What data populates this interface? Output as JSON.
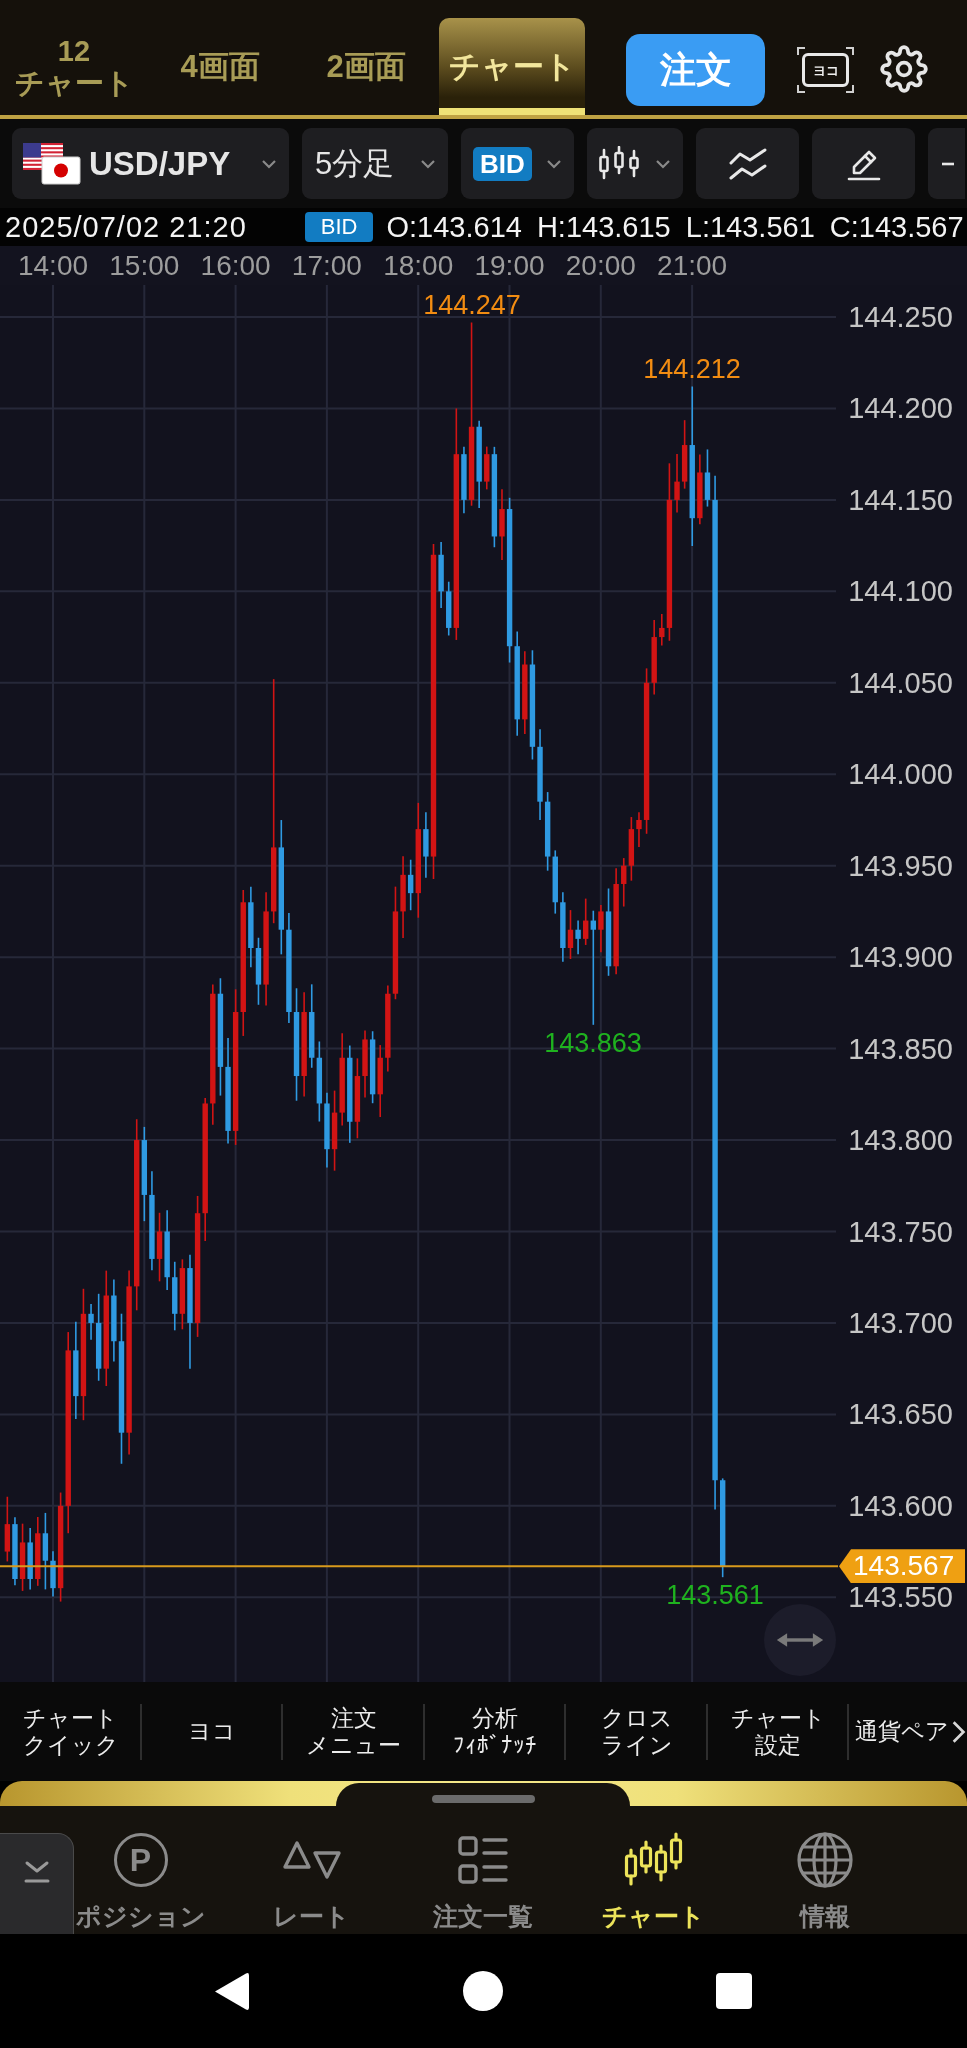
{
  "header": {
    "tabs": [
      {
        "lines": [
          "12",
          "チャート"
        ],
        "selected": false
      },
      {
        "lines": [
          "4画面"
        ],
        "selected": false
      },
      {
        "lines": [
          "2画面"
        ],
        "selected": false
      },
      {
        "lines": [
          "チャート"
        ],
        "selected": true
      }
    ],
    "order_button": "注文",
    "landscape_button": "ヨコ"
  },
  "toolbar": {
    "pair": "USD/JPY",
    "timeframe": "5分足",
    "price_type": "BID"
  },
  "ohlc": {
    "datetime": "2025/07/02 21:20",
    "price_type": "BID",
    "open": "O:143.614",
    "high": "H:143.615",
    "low": "L:143.561",
    "close": "C:143.567"
  },
  "chart": {
    "time_labels": [
      "14:00",
      "15:00",
      "16:00",
      "17:00",
      "18:00",
      "19:00",
      "20:00",
      "21:00"
    ],
    "price_labels": [
      "144.250",
      "144.200",
      "144.150",
      "144.100",
      "144.050",
      "144.000",
      "143.950",
      "143.900",
      "143.850",
      "143.800",
      "143.750",
      "143.700",
      "143.650",
      "143.600",
      "143.550"
    ],
    "markers": [
      {
        "text": "144.247",
        "kind": "high"
      },
      {
        "text": "144.212",
        "kind": "high"
      },
      {
        "text": "143.863",
        "kind": "low"
      },
      {
        "text": "143.561",
        "kind": "low"
      }
    ],
    "current_price": "143.567"
  },
  "chart_menu": [
    {
      "lines": [
        "チャート",
        "クイック"
      ]
    },
    {
      "lines": [
        "ヨコ"
      ]
    },
    {
      "lines": [
        "注文",
        "メニュー"
      ]
    },
    {
      "lines": [
        "分析",
        "ﾌｨﾎﾞﾅｯﾁ"
      ]
    },
    {
      "lines": [
        "クロス",
        "ライン"
      ]
    },
    {
      "lines": [
        "チャート",
        "設定"
      ]
    },
    {
      "lines": [
        "通貨ペア"
      ]
    }
  ],
  "bottom_nav": [
    {
      "label": "ポジション",
      "icon_text": "P",
      "selected": false
    },
    {
      "label": "レート",
      "selected": false
    },
    {
      "label": "注文一覧",
      "selected": false
    },
    {
      "label": "チャート",
      "selected": true
    },
    {
      "label": "情報",
      "selected": false
    }
  ]
}
